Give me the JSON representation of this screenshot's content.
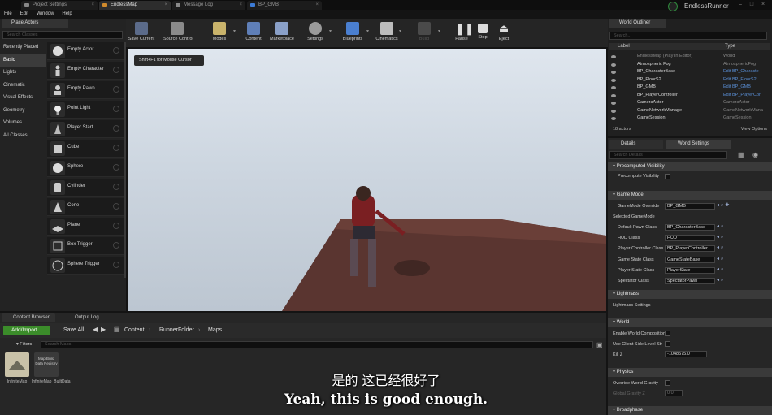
{
  "tabs": [
    {
      "label": "Project Settings",
      "active": false
    },
    {
      "label": "EndlessMap",
      "active": true
    },
    {
      "label": "Message Log",
      "active": false
    },
    {
      "label": "BP_GMB",
      "active": false
    }
  ],
  "app_title": "EndlessRunner",
  "menu": [
    "File",
    "Edit",
    "Window",
    "Help"
  ],
  "place_actors": {
    "tab_label": "Place Actors",
    "search_placeholder": "Search Classes",
    "categories": [
      "Recently Placed",
      "Basic",
      "Lights",
      "Cinematic",
      "Visual Effects",
      "Geometry",
      "Volumes",
      "All Classes"
    ],
    "selected_category": "Basic",
    "items": [
      "Empty Actor",
      "Empty Character",
      "Empty Pawn",
      "Point Light",
      "Player Start",
      "Cube",
      "Sphere",
      "Cylinder",
      "Cone",
      "Plane",
      "Box Trigger",
      "Sphere Trigger"
    ]
  },
  "toolbar": {
    "buttons": [
      {
        "label": "Save Current",
        "icon": "save-icon"
      },
      {
        "label": "Source Control",
        "icon": "source-control-icon"
      },
      {
        "label": "Modes",
        "icon": "modes-icon"
      },
      {
        "label": "Content",
        "icon": "content-icon"
      },
      {
        "label": "Marketplace",
        "icon": "marketplace-icon"
      },
      {
        "label": "Settings",
        "icon": "gear-icon"
      },
      {
        "label": "Blueprints",
        "icon": "blueprint-icon"
      },
      {
        "label": "Cinematics",
        "icon": "clapper-icon"
      },
      {
        "label": "Build",
        "icon": "build-icon"
      },
      {
        "label": "Pause",
        "icon": "pause-icon"
      },
      {
        "label": "Stop",
        "icon": "stop-icon"
      },
      {
        "label": "Eject",
        "icon": "eject-icon"
      }
    ]
  },
  "viewport": {
    "hint": "Shift+F1 for Mouse Cursor"
  },
  "world_outliner": {
    "tab_label": "World Outliner",
    "search_placeholder": "Search...",
    "col_label": "Label",
    "col_type": "Type",
    "rows": [
      {
        "label": "EndlessMap (Play In Editor)",
        "type": "World",
        "link": false
      },
      {
        "label": "Atmospheric Fog",
        "type": "AtmosphericFog",
        "link": false
      },
      {
        "label": "BP_CharacterBase",
        "type": "Edit BP_Characte",
        "link": true
      },
      {
        "label": "BP_FloorS2",
        "type": "Edit BP_FloorS2",
        "link": true
      },
      {
        "label": "BP_GMB",
        "type": "Edit BP_GMB",
        "link": true
      },
      {
        "label": "BP_PlayerController",
        "type": "Edit BP_PlayerCor",
        "link": true
      },
      {
        "label": "CameraActor",
        "type": "CameraActor",
        "link": false
      },
      {
        "label": "GameNetworkManage",
        "type": "GameNetworkMana",
        "link": false
      },
      {
        "label": "GameSession",
        "type": "GameSession",
        "link": false
      }
    ],
    "count": "18 actors",
    "view_options": "View Options"
  },
  "details": {
    "tab_details": "Details",
    "tab_world_settings": "World Settings",
    "search_placeholder": "Search Details",
    "sections": {
      "precomputed": "Precomputed Visibility",
      "game_mode": "Game Mode",
      "lightmass": "Lightmass",
      "world": "World",
      "physics": "Physics",
      "broadphase": "Broadphase"
    },
    "precomputed_visibility": "Precompute Visibility",
    "gamemode_override_label": "GameMode Override",
    "gamemode_override_value": "BP_GMB",
    "selected_gamemode": "Selected GameMode",
    "gm_rows": [
      {
        "label": "Default Pawn Class",
        "value": "BP_CharacterBase"
      },
      {
        "label": "HUD Class",
        "value": "HUD"
      },
      {
        "label": "Player Controller Class",
        "value": "BP_PlayerController"
      },
      {
        "label": "Game State Class",
        "value": "GameStateBase"
      },
      {
        "label": "Player State Class",
        "value": "PlayerState"
      },
      {
        "label": "Spectator Class",
        "value": "SpectatorPawn"
      }
    ],
    "lightmass_settings": "Lightmass Settings",
    "enable_world_composition": "Enable World Composition",
    "use_client_side_level": "Use Client Side Level Str",
    "kill_z_label": "Kill Z",
    "kill_z_value": "-1048575.0",
    "override_world_gravity": "Override World Gravity",
    "global_gravity_label": "Global Gravity Z",
    "global_gravity_value": "0.0"
  },
  "content_browser": {
    "tab_content": "Content Browser",
    "tab_output": "Output Log",
    "add_import": "Add/Import",
    "save_all": "Save All",
    "breadcrumb": [
      "Content",
      "RunnerFolder",
      "Maps"
    ],
    "filters": "Filters",
    "search_placeholder": "Search Maps",
    "assets": [
      {
        "label": "InfiniteMap"
      },
      {
        "label": "InfiniteMap_BuiltData"
      }
    ],
    "asset2_thumb_text": "Map Build Data Registry"
  },
  "subtitles": {
    "zh": "是的 这已经很好了",
    "en": "Yeah, this is good enough."
  }
}
